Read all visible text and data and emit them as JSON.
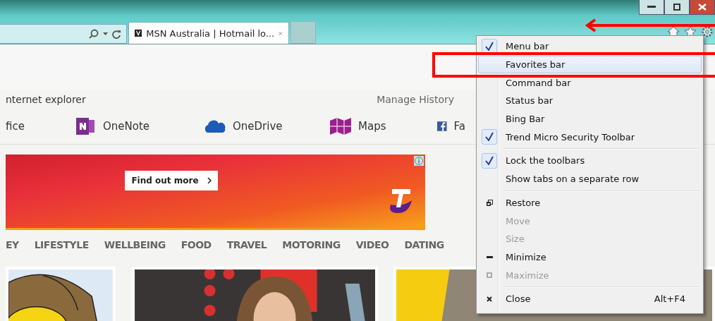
{
  "tab": {
    "title": "MSN Australia | Hotmail lo...",
    "selected": true
  },
  "page": {
    "history_left": "nternet explorer",
    "history_right": "Manage History",
    "links": [
      {
        "label": "fice"
      },
      {
        "label": "OneNote"
      },
      {
        "label": "OneDrive"
      },
      {
        "label": "Maps"
      },
      {
        "label": "Fa"
      }
    ],
    "ad": {
      "button": "Find out more"
    },
    "nav": [
      "EY",
      "LIFESTYLE",
      "WELLBEING",
      "FOOD",
      "TRAVEL",
      "MOTORING",
      "VIDEO",
      "DATING"
    ]
  },
  "context_menu": {
    "items": [
      {
        "kind": "toggle",
        "label": "Menu bar",
        "checked": true,
        "selected": false
      },
      {
        "kind": "toggle",
        "label": "Favorites bar",
        "checked": false,
        "selected": true
      },
      {
        "kind": "toggle",
        "label": "Command bar",
        "checked": false,
        "selected": false
      },
      {
        "kind": "toggle",
        "label": "Status bar",
        "checked": false,
        "selected": false
      },
      {
        "kind": "toggle",
        "label": "Bing Bar",
        "checked": false,
        "selected": false
      },
      {
        "kind": "toggle",
        "label": "Trend Micro Security Toolbar",
        "checked": true,
        "selected": false
      },
      {
        "kind": "separator"
      },
      {
        "kind": "toggle",
        "label": "Lock the toolbars",
        "checked": true,
        "selected": false
      },
      {
        "kind": "toggle",
        "label": "Show tabs on a separate row",
        "checked": false,
        "selected": false
      },
      {
        "kind": "separator"
      },
      {
        "kind": "command",
        "label": "Restore",
        "disabled": false
      },
      {
        "kind": "command",
        "label": "Move",
        "disabled": true
      },
      {
        "kind": "command",
        "label": "Size",
        "disabled": true
      },
      {
        "kind": "command",
        "label": "Minimize",
        "disabled": false
      },
      {
        "kind": "command",
        "label": "Maximize",
        "disabled": true
      },
      {
        "kind": "separator"
      },
      {
        "kind": "command",
        "label": "Close",
        "disabled": false,
        "shortcut": "Alt+F4"
      }
    ]
  }
}
